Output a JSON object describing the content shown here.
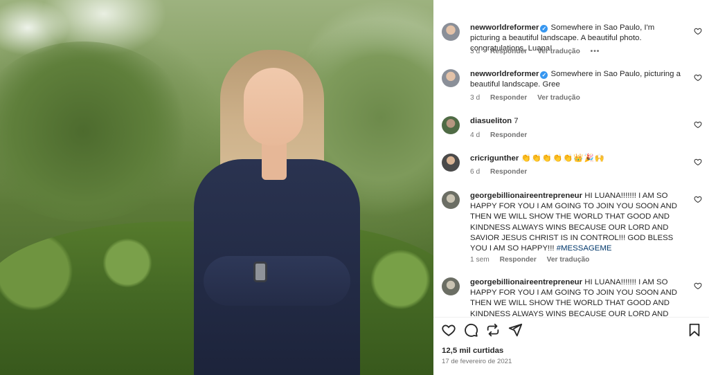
{
  "comments": [
    {
      "username": "newworldreformer",
      "verified": true,
      "text": "Somewhere in Sao Paulo, I'm picturing a beautiful landscape. A beautiful photo. congratulations, Luana!",
      "time": "3 d",
      "reply_label": "Responder",
      "translation_label": "Ver tradução",
      "more_label": "•••"
    },
    {
      "username": "newworldreformer",
      "verified": true,
      "text": "Somewhere in Sao Paulo, picturing a beautiful landscape. Gree",
      "time": "3 d",
      "reply_label": "Responder",
      "translation_label": "Ver tradução"
    },
    {
      "username": "diasueliton",
      "text": "7",
      "time": "4 d",
      "reply_label": "Responder"
    },
    {
      "username": "cricrigunther",
      "text": "👏👏👏👏👏👑🎉🙌",
      "time": "6 d",
      "reply_label": "Responder"
    },
    {
      "username": "georgebillionaireentrepreneur",
      "text": "HI LUANA!!!!!!! I AM SO HAPPY FOR YOU I AM GOING TO JOIN YOU SOON AND THEN WE WILL SHOW THE WORLD THAT GOOD AND KINDNESS ALWAYS WINS BECAUSE OUR LORD AND SAVIOR JESUS CHRIST IS IN CONTROL!!! GOD BLESS YOU I AM SO HAPPY!!!",
      "hashtag": "#MESSAGEME",
      "time": "1 sem",
      "reply_label": "Responder",
      "translation_label": "Ver tradução"
    },
    {
      "username": "georgebillionaireentrepreneur",
      "text": "HI LUANA!!!!!!! I AM SO HAPPY FOR YOU I AM GOING TO JOIN YOU SOON AND THEN WE WILL SHOW THE WORLD THAT GOOD AND KINDNESS ALWAYS WINS BECAUSE OUR LORD AND SAVIOR JESUS"
    }
  ],
  "icons": {
    "verified": "verified-badge-icon",
    "comment_like": "heart-outline-icon",
    "like": "heart-icon",
    "comment": "speech-bubble-icon",
    "share": "repost-icon",
    "send": "paper-plane-icon",
    "save": "bookmark-icon"
  },
  "post": {
    "likes": "12,5 mil curtidas",
    "date": "17 de fevereiro de 2021"
  },
  "colors": {
    "verified": "#3797f0",
    "muted": "#737373",
    "hashtag": "#00376b",
    "text": "#262626"
  }
}
